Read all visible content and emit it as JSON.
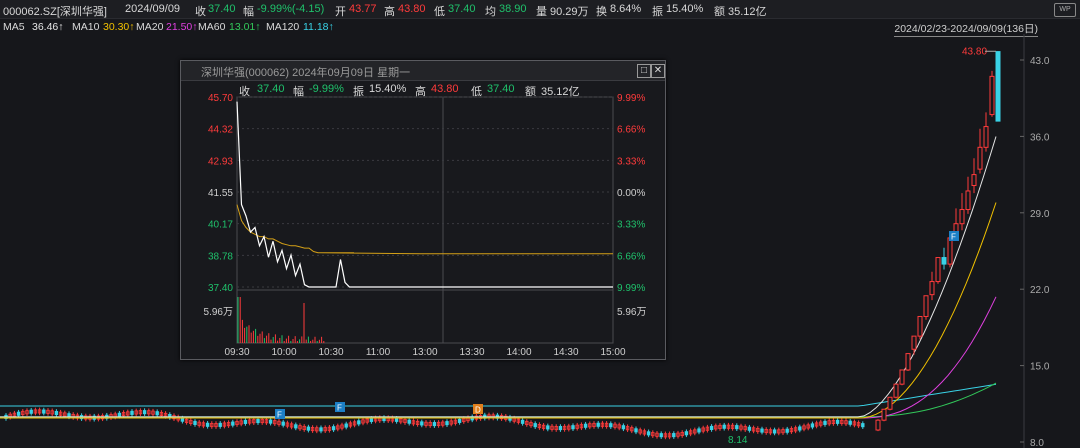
{
  "header": {
    "code": "000062.SZ[深圳华强]",
    "date": "2024/09/09",
    "close_label": "收",
    "close": "37.40",
    "change_label": "幅",
    "change": "-9.99%(-4.15)",
    "open_label": "开",
    "open": "43.77",
    "high_label": "高",
    "high": "43.80",
    "low_label": "低",
    "low": "37.40",
    "avg_label": "均",
    "avg": "38.90",
    "volume_label": "量",
    "volume": "90.29万",
    "turnover_label": "换",
    "turnover": "8.64%",
    "amplitude_label": "振",
    "amplitude": "15.40%",
    "amount_label": "额",
    "amount": "35.12亿",
    "app_badge": "WP"
  },
  "ma_bar": {
    "ma5": "MA5",
    "ma5_value": "36.46↑",
    "ma10": "MA10",
    "ma10_value": "30.30↑",
    "ma20": "MA20",
    "ma20_value": "21.50↑",
    "ma60": "MA60",
    "ma60_value": "13.01↑",
    "ma120": "MA120",
    "ma120_value": "11.18↑",
    "date_range": "2024/02/23-2024/09/09(136日)"
  },
  "colors": {
    "up": "#ff3b3b",
    "down": "#39d2e6",
    "ma5": "#e6e6e6",
    "ma10": "#f0c000",
    "ma20": "#e040e0",
    "ma60": "#32c85a",
    "ma120": "#39d2e6",
    "avg_line": "#d4a017"
  },
  "chart_data": [
    {
      "type": "candlestick",
      "title": "000062.SZ[深圳华强] 日K",
      "price_axis": [
        "43.0",
        "36.0",
        "29.0",
        "22.0",
        "15.0",
        "8.0"
      ],
      "ylim": [
        8.0,
        43.0
      ],
      "labels": {
        "high": "43.80",
        "low": "8.14"
      },
      "markers": [
        "F",
        "F",
        "D",
        "F"
      ],
      "recent_candles": [
        {
          "o": 9.1,
          "c": 10.0,
          "h": 10.1,
          "l": 9.0
        },
        {
          "o": 10.0,
          "c": 11.0,
          "h": 11.0,
          "l": 9.9
        },
        {
          "o": 11.0,
          "c": 12.1,
          "h": 12.1,
          "l": 10.9
        },
        {
          "o": 12.1,
          "c": 13.3,
          "h": 13.3,
          "l": 12.0
        },
        {
          "o": 13.3,
          "c": 14.6,
          "h": 14.6,
          "l": 13.2
        },
        {
          "o": 14.6,
          "c": 16.1,
          "h": 16.1,
          "l": 14.5
        },
        {
          "o": 16.5,
          "c": 17.7,
          "h": 17.7,
          "l": 16.0
        },
        {
          "o": 17.7,
          "c": 19.5,
          "h": 19.5,
          "l": 17.4
        },
        {
          "o": 19.5,
          "c": 21.4,
          "h": 21.4,
          "l": 19.2
        },
        {
          "o": 21.5,
          "c": 22.7,
          "h": 23.6,
          "l": 21.0
        },
        {
          "o": 22.7,
          "c": 24.9,
          "h": 24.9,
          "l": 22.5
        },
        {
          "o": 24.9,
          "c": 24.3,
          "h": 25.8,
          "l": 23.8
        },
        {
          "o": 24.3,
          "c": 26.7,
          "h": 26.7,
          "l": 24.0
        },
        {
          "o": 26.9,
          "c": 28.0,
          "h": 29.4,
          "l": 26.5
        },
        {
          "o": 28.0,
          "c": 29.3,
          "h": 30.8,
          "l": 27.4
        },
        {
          "o": 29.3,
          "c": 31.0,
          "h": 32.3,
          "l": 28.9
        },
        {
          "o": 31.5,
          "c": 32.5,
          "h": 34.0,
          "l": 30.8
        },
        {
          "o": 33.0,
          "c": 35.0,
          "h": 36.7,
          "l": 32.6
        },
        {
          "o": 35.0,
          "c": 36.9,
          "h": 38.2,
          "l": 34.6
        },
        {
          "o": 38.0,
          "c": 41.5,
          "h": 42.0,
          "l": 37.8
        },
        {
          "o": 43.77,
          "c": 37.4,
          "h": 43.8,
          "l": 37.4
        }
      ]
    },
    {
      "type": "line",
      "title": "深圳华强(000062) 2024年09月09日 星期一",
      "quote": {
        "close_label": "收",
        "close": "37.40",
        "change_label": "幅",
        "change": "-9.99%",
        "amplitude_label": "振",
        "amplitude": "15.40%",
        "high_label": "高",
        "high": "43.80",
        "low_label": "低",
        "low": "37.40",
        "amount_label": "额",
        "amount": "35.12亿"
      },
      "price_ticks": [
        "45.70",
        "44.32",
        "42.93",
        "41.55",
        "40.17",
        "38.78",
        "37.40"
      ],
      "pct_ticks": [
        "9.99%",
        "6.66%",
        "3.33%",
        "0.00%",
        "3.33%",
        "6.66%",
        "9.99%"
      ],
      "volume_label": "5.96万",
      "x_ticks": [
        "09:30",
        "10:00",
        "10:30",
        "11:00",
        "13:00",
        "13:30",
        "14:00",
        "14:30",
        "15:00"
      ],
      "ylim": [
        37.4,
        45.7
      ],
      "series": [
        {
          "values": [
            45.5,
            41.0,
            40.5,
            39.8,
            40.0,
            39.2,
            39.6,
            38.7,
            39.4,
            38.5,
            39.0,
            38.2,
            38.8,
            37.9,
            38.4,
            37.5,
            37.4,
            37.4,
            37.4,
            37.4,
            37.4,
            37.4,
            37.4,
            38.6,
            37.6,
            37.4,
            37.4
          ]
        },
        {
          "values": [
            41.0,
            40.3,
            40.0,
            39.8,
            39.7,
            39.6,
            39.6,
            39.5,
            39.5,
            39.4,
            39.3,
            39.25,
            39.2,
            39.2,
            39.15,
            39.1,
            39.1,
            38.95,
            38.9,
            38.9,
            38.9,
            38.9,
            38.9,
            38.9,
            38.9,
            38.9,
            38.9
          ]
        }
      ]
    }
  ]
}
